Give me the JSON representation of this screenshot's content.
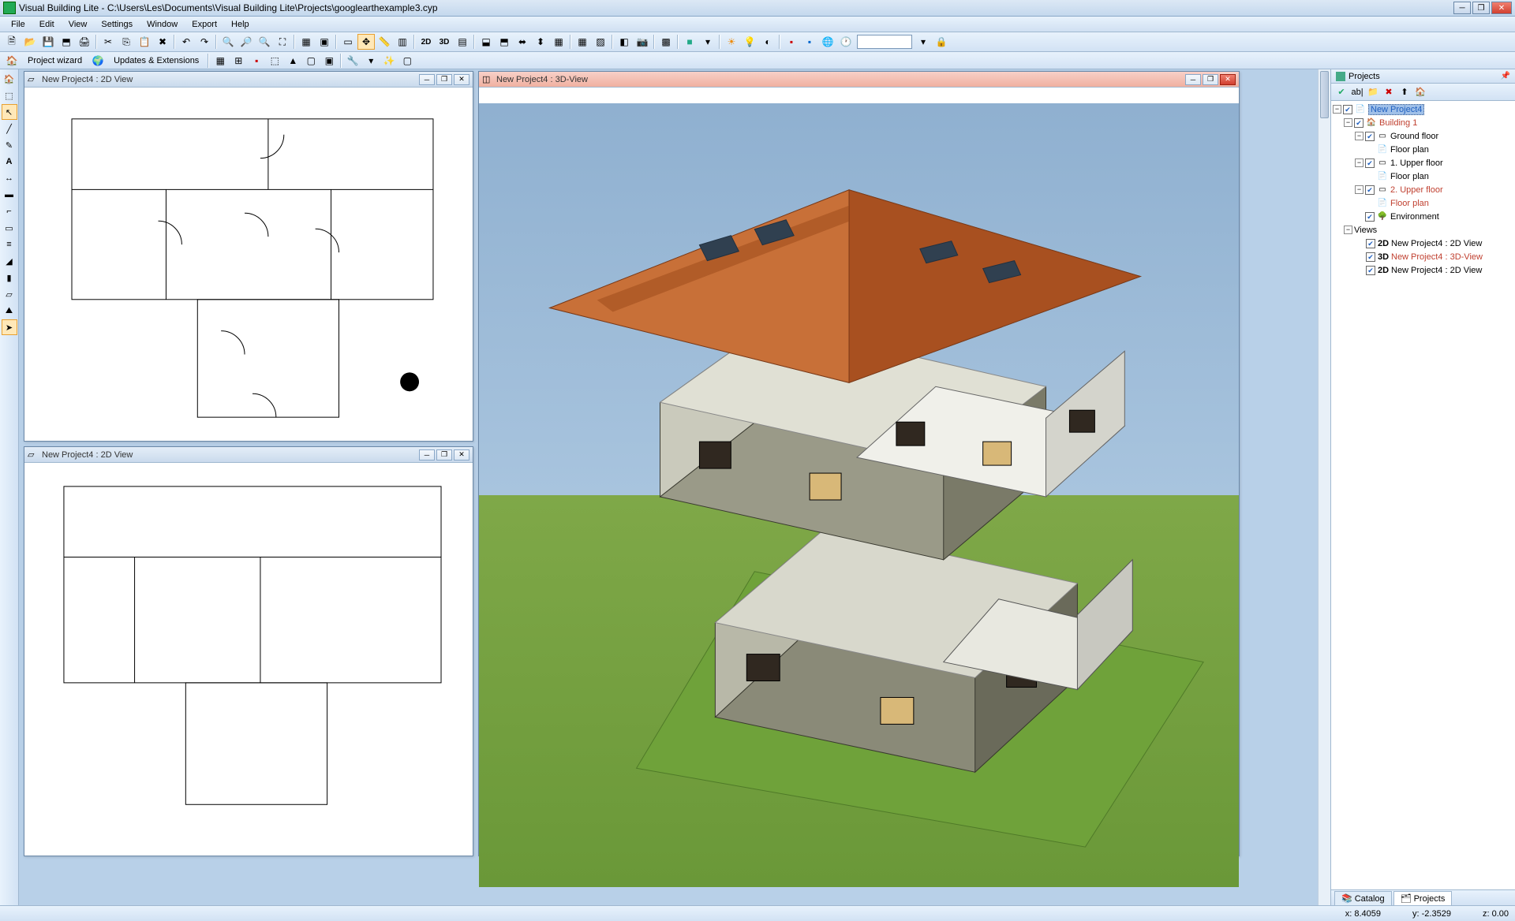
{
  "titlebar": {
    "title": "Visual Building Lite - C:\\Users\\Les\\Documents\\Visual Building Lite\\Projects\\googlearthexample3.cyp"
  },
  "menu": [
    "File",
    "Edit",
    "View",
    "Settings",
    "Window",
    "Export",
    "Help"
  ],
  "secondbar": {
    "project_wizard": "Project wizard",
    "updates": "Updates & Extensions"
  },
  "doc1": {
    "title": "New Project4 : 2D View"
  },
  "doc2": {
    "title": "New Project4 : 2D View"
  },
  "doc3": {
    "title": "New Project4 : 3D-View"
  },
  "projects_panel": {
    "title": "Projects"
  },
  "tree": {
    "root": "New Project4",
    "building": "Building 1",
    "ground": "Ground floor",
    "floorplan": "Floor plan",
    "upper1": "1. Upper floor",
    "upper2": "2. Upper floor",
    "env": "Environment",
    "views": "Views",
    "v1_type": "2D",
    "v1_label": "New Project4 : 2D View",
    "v2_type": "3D",
    "v2_label": "New Project4 : 3D-View",
    "v3_type": "2D",
    "v3_label": "New Project4 : 2D View"
  },
  "bottom_tabs": {
    "catalog": "Catalog",
    "projects": "Projects"
  },
  "status": {
    "x_label": "x:",
    "x_val": "8.4059",
    "y_label": "y:",
    "y_val": "-2.3529",
    "z_label": "z:",
    "z_val": "0.00"
  },
  "icons": {
    "2d": "2D",
    "3d": "3D"
  }
}
